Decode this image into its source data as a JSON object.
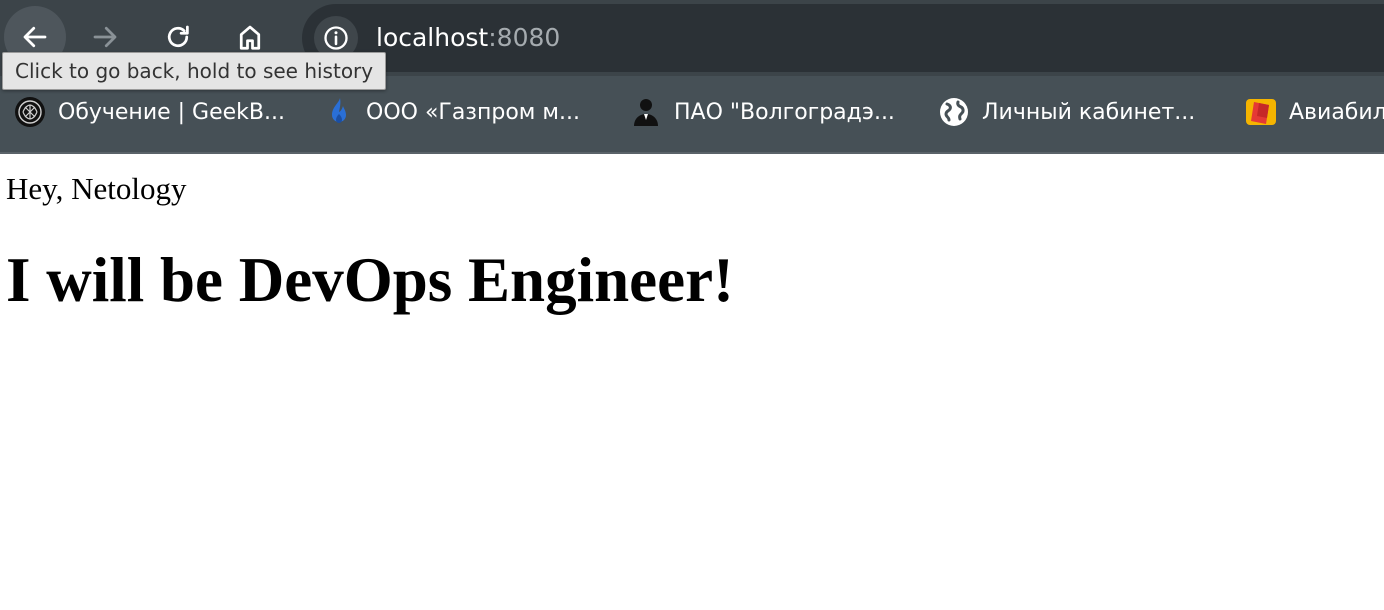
{
  "toolbar": {
    "back_icon": "arrow-left-icon",
    "forward_icon": "arrow-right-icon",
    "reload_icon": "reload-icon",
    "home_icon": "home-icon",
    "info_icon": "info-icon",
    "url_host": "localhost",
    "url_port": ":8080"
  },
  "tooltip": {
    "text": "Click to go back, hold to see history"
  },
  "bookmarks": [
    {
      "label": "Обучение | GeekB...",
      "icon": "geekbrains-icon"
    },
    {
      "label": "ООО «Газпром м...",
      "icon": "gazprom-flame-icon"
    },
    {
      "label": "ПАО \"Волгоградэ...",
      "icon": "person-icon"
    },
    {
      "label": "Личный кабинет...",
      "icon": "globe-icon"
    },
    {
      "label": "Авиабил",
      "icon": "ticket-icon"
    }
  ],
  "page": {
    "greeting": "Hey, Netology",
    "headline": "I will be DevOps Engineer!"
  },
  "colors": {
    "toolbar_bg": "#3c4449",
    "omnibox_bg": "#2b3136",
    "bookmarks_bg": "#465056",
    "page_bg": "#ffffff"
  }
}
